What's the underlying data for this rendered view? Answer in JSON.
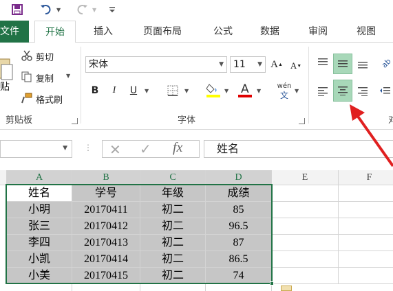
{
  "quick_access": {
    "icons": [
      "save-icon",
      "undo-icon",
      "redo-icon",
      "customize-icon"
    ]
  },
  "tabs": [
    {
      "label": "文件",
      "display": "文件"
    },
    {
      "label": "开始"
    },
    {
      "label": "插入"
    },
    {
      "label": "页面布局"
    },
    {
      "label": "公式"
    },
    {
      "label": "数据"
    },
    {
      "label": "审阅"
    },
    {
      "label": "视图"
    }
  ],
  "ribbon": {
    "clipboard": {
      "paste_label": "贴",
      "cut_label": "剪切",
      "copy_label": "复制",
      "format_painter_label": "格式刷",
      "group_label": "剪贴板"
    },
    "font": {
      "font_name": "宋体",
      "font_size": "11",
      "bold": "B",
      "italic": "I",
      "underline": "U",
      "wen_label": "wén",
      "wen_sub": "文",
      "group_label": "字体",
      "fill_color": "#ffff00",
      "font_color": "#e00000"
    },
    "alignment": {
      "group_label_partial": "对"
    }
  },
  "formula_bar": {
    "cancel": "✕",
    "enter": "✓",
    "fx": "fx",
    "content": "姓名"
  },
  "grid": {
    "columns": [
      "A",
      "B",
      "C",
      "D",
      "E",
      "F"
    ],
    "rows": [
      [
        "姓名",
        "学号",
        "年级",
        "成绩"
      ],
      [
        "小明",
        "20170411",
        "初二",
        "85"
      ],
      [
        "张三",
        "20170412",
        "初二",
        "96.5"
      ],
      [
        "李四",
        "20170413",
        "初二",
        "87"
      ],
      [
        "小凯",
        "20170414",
        "初二",
        "86.5"
      ],
      [
        "小美",
        "20170415",
        "初二",
        "74"
      ]
    ]
  },
  "colors": {
    "accent": "#217346",
    "selection_fill": "#c6c6c6",
    "arrow": "#e02020"
  }
}
